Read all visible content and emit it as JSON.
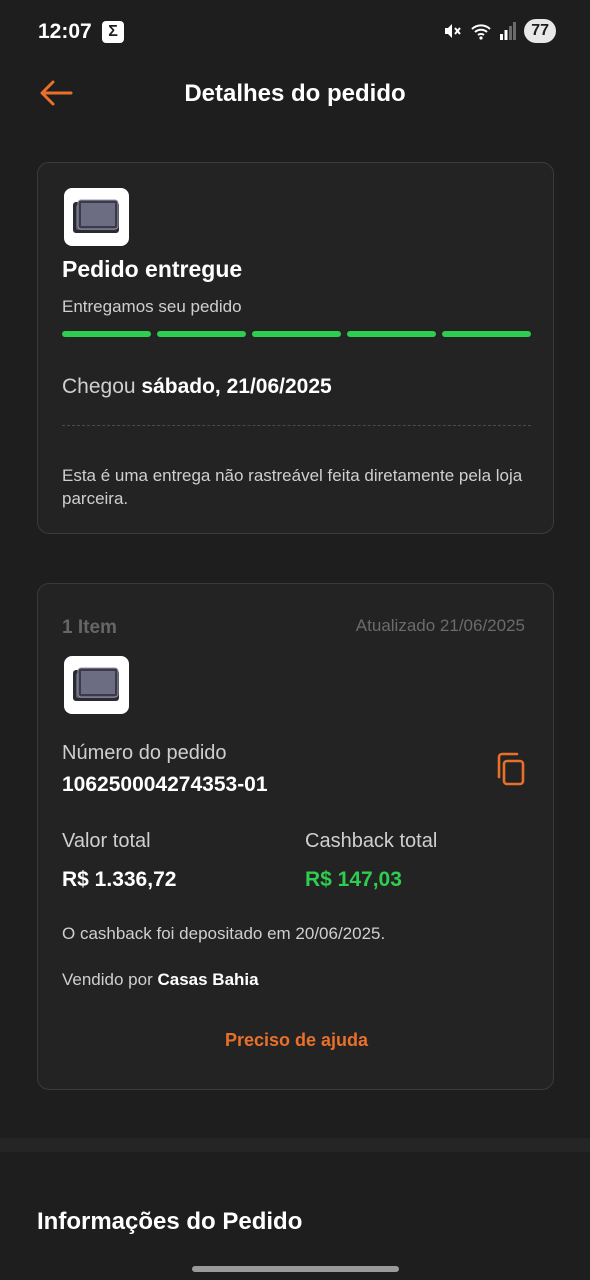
{
  "status_bar": {
    "time": "12:07",
    "app_icon_glyph": "Σ",
    "battery": "77",
    "icons": [
      "mute-icon",
      "wifi-icon",
      "signal-icon"
    ]
  },
  "header": {
    "title": "Detalhes do pedido",
    "back_icon": "arrow-left-icon"
  },
  "colors": {
    "accent": "#e8702a",
    "success": "#2ecc4f",
    "background": "#1e1e1e"
  },
  "delivery_card": {
    "product_icon": "tablet-icon",
    "status_title": "Pedido entregue",
    "status_subtitle": "Entregamos seu pedido",
    "progress_steps_completed": 5,
    "progress_steps_total": 5,
    "arrival_prefix": "Chegou",
    "arrival_date": "sábado, 21/06/2025",
    "note": "Esta é uma entrega não rastreável feita diretamente pela loja parceira."
  },
  "order_card": {
    "item_count": "1 Item",
    "updated": "Atualizado 21/06/2025",
    "product_icon": "tablet-icon",
    "order_number_label": "Número do pedido",
    "order_number": "106250004274353-01",
    "copy_icon": "copy-icon",
    "total_label": "Valor total",
    "total_value": "R$ 1.336,72",
    "cashback_label": "Cashback total",
    "cashback_value": "R$ 147,03",
    "cashback_note": "O cashback foi depositado em 20/06/2025.",
    "sold_by_prefix": "Vendido por",
    "sold_by_store": "Casas Bahia",
    "help_label": "Preciso de ajuda"
  },
  "info_section": {
    "title": "Informações do Pedido"
  }
}
